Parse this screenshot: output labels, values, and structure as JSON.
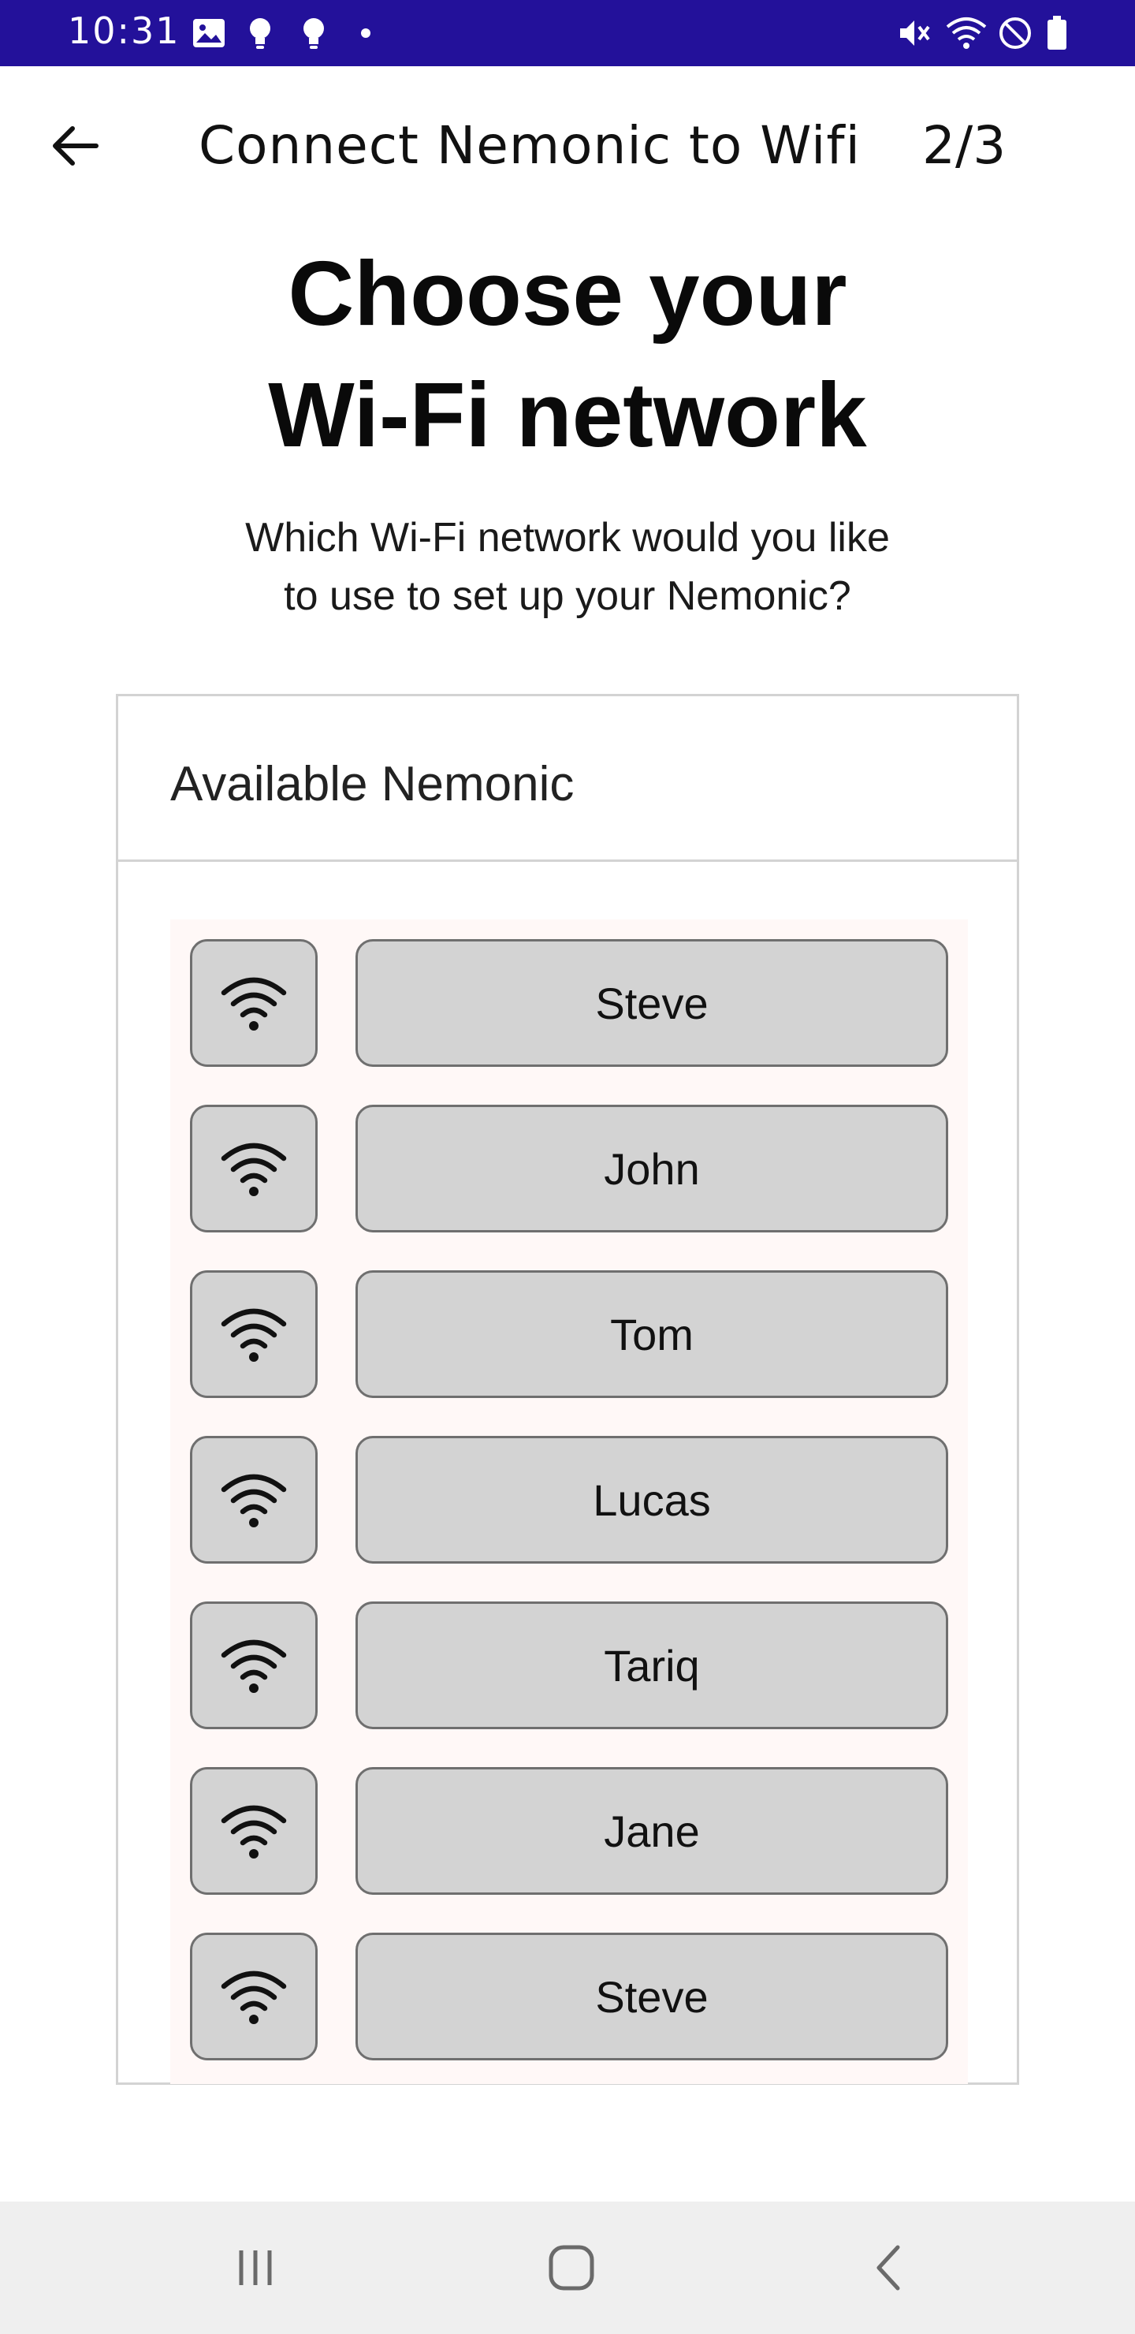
{
  "status_bar": {
    "time": "10:31",
    "background_color": "#23119a",
    "left_icons": [
      "image-icon",
      "lightbulb-icon",
      "lightbulb-icon",
      "dot-icon"
    ],
    "right_icons": [
      "mute-icon",
      "wifi-icon",
      "do-not-disturb-icon",
      "battery-icon"
    ]
  },
  "app_bar": {
    "back_icon": "arrow-left-icon",
    "title": "Connect Nemonic to Wifi",
    "step": "2/3"
  },
  "heading": {
    "line1": "Choose your",
    "line2": "Wi-Fi network"
  },
  "subtitle": {
    "line1": "Which Wi-Fi network would you like",
    "line2": "to use to set up your Nemonic?"
  },
  "card": {
    "title": "Available Nemonic",
    "networks": [
      {
        "name": "Steve",
        "icon": "wifi-icon"
      },
      {
        "name": "John",
        "icon": "wifi-icon"
      },
      {
        "name": "Tom",
        "icon": "wifi-icon"
      },
      {
        "name": "Lucas",
        "icon": "wifi-icon"
      },
      {
        "name": "Tariq",
        "icon": "wifi-icon"
      },
      {
        "name": "Jane",
        "icon": "wifi-icon"
      },
      {
        "name": "Steve",
        "icon": "wifi-icon"
      }
    ]
  },
  "nav_bar": {
    "recents_icon": "recents-icon",
    "home_icon": "home-icon",
    "back_icon": "chevron-left-icon"
  }
}
